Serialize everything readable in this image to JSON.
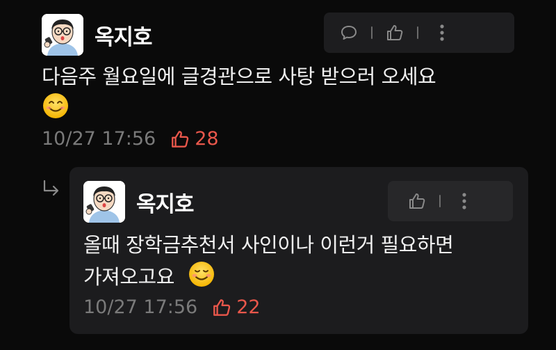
{
  "comment": {
    "author": "옥지호",
    "text": "다음주 월요일에 글경관으로 사탕 받으러 오세요",
    "emoji": "smiling-face-with-smiling-eyes",
    "timestamp": "10/27 17:56",
    "likes": "28"
  },
  "reply": {
    "author": "옥지호",
    "line1": "올때 장학금추천서 사인이나 이런거 필요하면",
    "line2": "가져오고요",
    "emoji": "smiling-face",
    "timestamp": "10/27 17:56",
    "likes": "22"
  },
  "colors": {
    "background": "#0a0a0a",
    "card": "#1c1c1e",
    "like_accent": "#e9574b",
    "meta_text": "#7a7a7a"
  }
}
